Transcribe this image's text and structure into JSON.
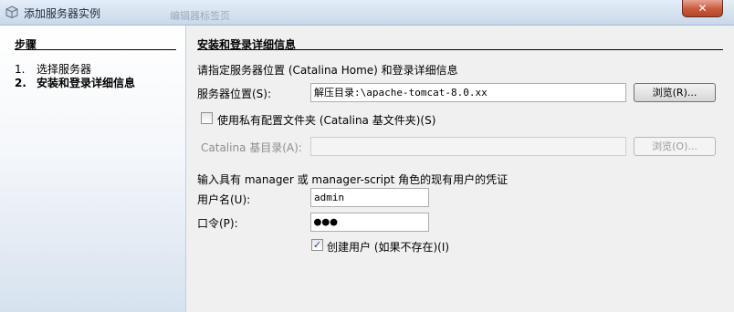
{
  "window": {
    "title": "添加服务器实例",
    "background_title": "编辑器标签页",
    "close_label": "✕"
  },
  "steps": {
    "title": "步骤",
    "items": [
      {
        "num": "1.",
        "label": "选择服务器"
      },
      {
        "num": "2.",
        "label": "安装和登录详细信息"
      }
    ]
  },
  "main": {
    "title": "安装和登录详细信息",
    "instruction": "请指定服务器位置 (Catalina Home) 和登录详细信息",
    "server_location_label": "服务器位置(S):",
    "server_location_value": "解压目录:\\apache-tomcat-8.0.xx",
    "browse_label": "浏览(R)...",
    "private_config_label": "使用私有配置文件夹 (Catalina 基文件夹)(S)",
    "private_config_checked": false,
    "catalina_base_label": "Catalina 基目录(A):",
    "catalina_base_value": "",
    "browse2_label": "浏览(O)...",
    "credentials_instruction": "输入具有 manager 或 manager-script 角色的现有用户的凭证",
    "username_label": "用户名(U):",
    "username_value": "admin",
    "password_label": "口令(P):",
    "password_value": "●●●",
    "create_user_label": "创建用户 (如果不存在)(I)",
    "create_user_checked": true,
    "check_mark": "✓"
  },
  "colors": {
    "accent": "#21448b",
    "close_button": "#c75a3e"
  }
}
